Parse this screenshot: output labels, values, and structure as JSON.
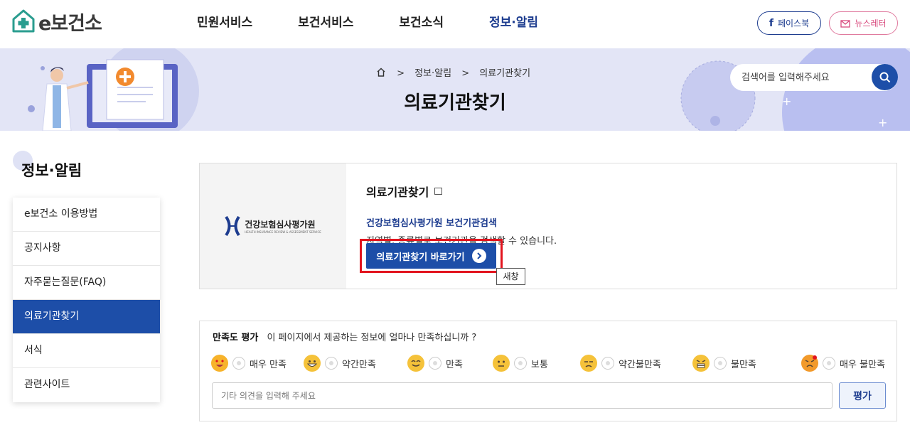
{
  "logo": {
    "text": "e보건소"
  },
  "gnb": [
    {
      "label": "민원서비스"
    },
    {
      "label": "보건서비스"
    },
    {
      "label": "보건소식"
    },
    {
      "label": "정보·알림"
    }
  ],
  "social": {
    "facebook": "페이스북",
    "newsletter": "뉴스레터"
  },
  "breadcrumb": {
    "level1": "정보·알림",
    "level2": "의료기관찾기",
    "separator": ">"
  },
  "page_title": "의료기관찾기",
  "search": {
    "placeholder": "검색어를 입력해주세요"
  },
  "sidebar": {
    "title": "정보·알림",
    "items": [
      {
        "label": "e보건소 이용방법"
      },
      {
        "label": "공지사항"
      },
      {
        "label": "자주묻는질문(FAQ)"
      },
      {
        "label": "의료기관찾기"
      },
      {
        "label": "서식"
      },
      {
        "label": "관련사이트"
      }
    ]
  },
  "card": {
    "org_name": "건강보험심사평가원",
    "org_name_en": "HEALTH INSURANCE REVIEW & ASSESSMENT SERVICE",
    "title": "의료기관찾기",
    "subtitle": "건강보험심사평가원 보건기관검색",
    "description": "지역별, 종류별로 보건기관을 검색할 수 있습니다.",
    "button": "의료기관찾기 바로가기",
    "tooltip": "새창"
  },
  "survey": {
    "title": "만족도 평가",
    "question": "이 페이지에서 제공하는 정보에 얼마나 만족하십니까 ?",
    "options": [
      {
        "label": "매우 만족"
      },
      {
        "label": "약간만족"
      },
      {
        "label": "만족"
      },
      {
        "label": "보통"
      },
      {
        "label": "약간불만족"
      },
      {
        "label": "불만족"
      },
      {
        "label": "매우 불만족"
      }
    ],
    "placeholder": "기타 의견을 입력해 주세요",
    "submit": "평가"
  },
  "colors": {
    "primary": "#1d4ea8",
    "banner": "#e3e5f6",
    "highlight": "#e2141e"
  }
}
